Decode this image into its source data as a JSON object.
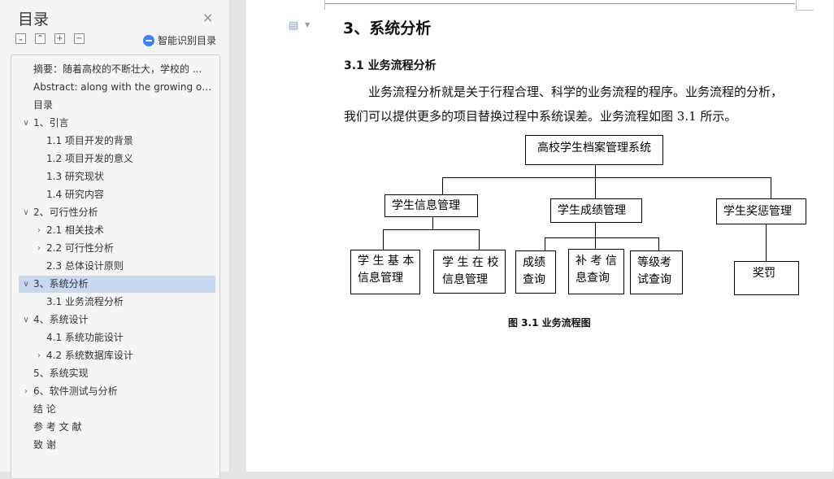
{
  "toc": {
    "title": "目录",
    "smart_toc_label": "智能识别目录",
    "close_glyph": "×",
    "tools": [
      "⌄",
      "⌃",
      "+",
      "−"
    ],
    "items": [
      {
        "label": "摘要：随着高校的不断壮大，学校的 ...",
        "level": 1,
        "chev": ""
      },
      {
        "label": "Abstract: along with the growing of...",
        "level": 1,
        "chev": ""
      },
      {
        "label": "目录",
        "level": 1,
        "chev": ""
      },
      {
        "label": "1、引言",
        "level": 1,
        "chev": "v"
      },
      {
        "label": "1.1 项目开发的背景",
        "level": 2,
        "chev": ""
      },
      {
        "label": "1.2 项目开发的意义",
        "level": 2,
        "chev": ""
      },
      {
        "label": "1.3 研究现状",
        "level": 2,
        "chev": ""
      },
      {
        "label": "1.4 研究内容",
        "level": 2,
        "chev": ""
      },
      {
        "label": "2、可行性分析",
        "level": 1,
        "chev": "v"
      },
      {
        "label": "2.1 相关技术",
        "level": 2,
        "chev": ">"
      },
      {
        "label": "2.2 可行性分析",
        "level": 2,
        "chev": ">"
      },
      {
        "label": "2.3 总体设计原则",
        "level": 2,
        "chev": ""
      },
      {
        "label": "3、系统分析",
        "level": 1,
        "chev": "v",
        "active": true
      },
      {
        "label": "3.1 业务流程分析",
        "level": 2,
        "chev": ""
      },
      {
        "label": "4、系统设计",
        "level": 1,
        "chev": "v"
      },
      {
        "label": "4.1 系统功能设计",
        "level": 2,
        "chev": ""
      },
      {
        "label": "4.2 系统数据库设计",
        "level": 2,
        "chev": ">"
      },
      {
        "label": "5、系统实现",
        "level": 1,
        "chev": ""
      },
      {
        "label": "6、软件测试与分析",
        "level": 1,
        "chev": ">"
      },
      {
        "label": "结  论",
        "level": 1,
        "chev": ""
      },
      {
        "label": "参 考 文 献",
        "level": 1,
        "chev": ""
      },
      {
        "label": "致   谢",
        "level": 1,
        "chev": ""
      }
    ]
  },
  "document": {
    "heading1": "3、系统分析",
    "heading2": "3.1 业务流程分析",
    "para_line1": "业务流程分析就是关于行程合理、科学的业务流程的程序。业务流程的分析，",
    "para_line2": "我们可以提供更多的项目替换过程中系统误差。业务流程如图 3.1 所示。",
    "caption": "图 3.1 业务流程图",
    "flowchart": {
      "root": "高校学生档案管理系统",
      "branch1": "学生信息管理",
      "branch2": "学生成绩管理",
      "branch3": "学生奖惩管理",
      "leaf1a": "学 生 基 本\n信息管理",
      "leaf1b": "学 生 在 校\n信息管理",
      "leaf2a": "成绩\n查询",
      "leaf2b": "补 考 信\n息查询",
      "leaf2c": "等级考\n试查询",
      "leaf3a": "奖罚"
    }
  }
}
